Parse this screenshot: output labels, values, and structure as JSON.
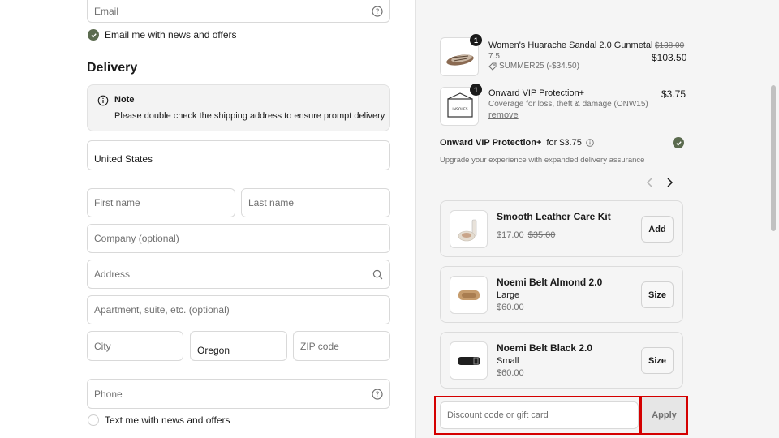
{
  "contact": {
    "email_placeholder": "Email",
    "email_news_label": "Email me with news and offers",
    "email_news_checked": true
  },
  "delivery": {
    "heading": "Delivery",
    "note_title": "Note",
    "note_body": "Please double check the shipping address to ensure prompt delivery",
    "country_value": "United States",
    "first_name_placeholder": "First name",
    "last_name_placeholder": "Last name",
    "company_placeholder": "Company (optional)",
    "address_placeholder": "Address",
    "apartment_placeholder": "Apartment, suite, etc. (optional)",
    "city_placeholder": "City",
    "state_value": "Oregon",
    "zip_placeholder": "ZIP code",
    "phone_placeholder": "Phone",
    "text_news_label": "Text me with news and offers",
    "text_news_checked": false
  },
  "order": {
    "items": [
      {
        "qty": "1",
        "name": "Women's Huarache Sandal 2.0 Gunmetal",
        "variant": "7.5",
        "discount": "SUMMER25 (-$34.50)",
        "original_price": "$138.00",
        "price": "$103.50"
      },
      {
        "qty": "1",
        "name": "Onward VIP Protection+",
        "variant": "Coverage for loss, theft & damage (ONW15)",
        "remove_label": "remove",
        "price": "$3.75",
        "thumb_text": "INSOLES"
      }
    ],
    "protection": {
      "title": "Onward VIP Protection+",
      "price_text": "for $3.75",
      "subtitle": "Upgrade your experience with expanded delivery assurance",
      "checked": true
    },
    "upsells": [
      {
        "name": "Smooth Leather Care Kit",
        "price": "$17.00",
        "original_price": "$35.00",
        "button": "Add"
      },
      {
        "name": "Noemi Belt Almond 2.0",
        "variant": "Large",
        "price": "$60.00",
        "button": "Size"
      },
      {
        "name": "Noemi Belt Black 2.0",
        "variant": "Small",
        "price": "$60.00",
        "button": "Size"
      }
    ],
    "discount_placeholder": "Discount code or gift card",
    "apply_label": "Apply"
  },
  "colors": {
    "accent_check": "#5b6b4f",
    "highlight": "#d40000"
  }
}
